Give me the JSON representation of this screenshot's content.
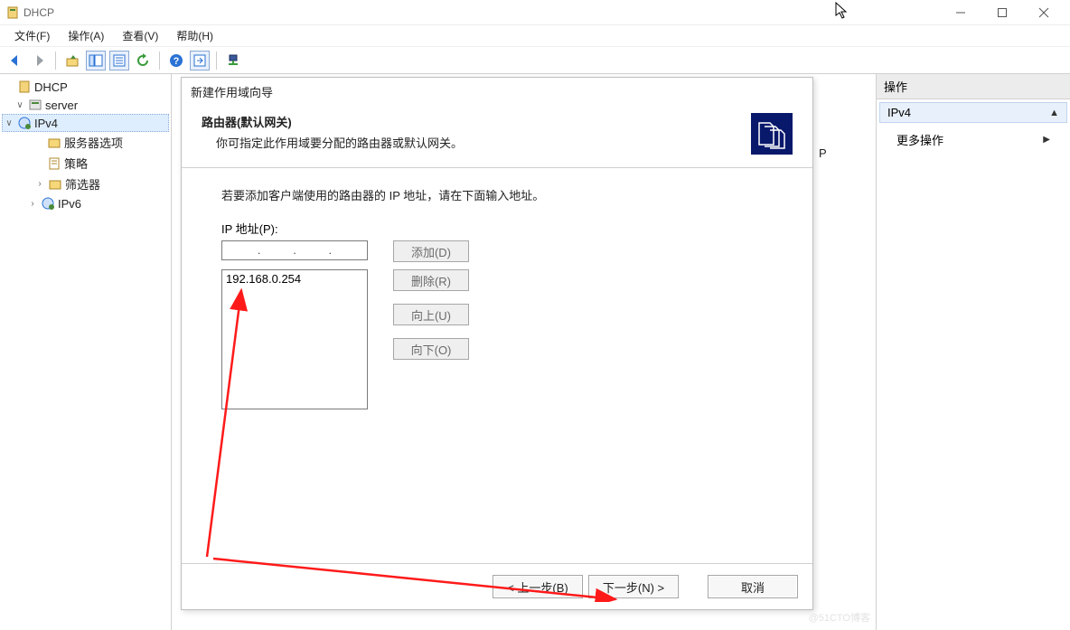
{
  "window": {
    "title": "DHCP"
  },
  "menu": {
    "file": "文件(F)",
    "action": "操作(A)",
    "view": "查看(V)",
    "help": "帮助(H)"
  },
  "tree": {
    "root": "DHCP",
    "server": "server",
    "ipv4": "IPv4",
    "server_options": "服务器选项",
    "policies": "策略",
    "filters": "筛选器",
    "ipv6": "IPv6"
  },
  "side_letter": "P",
  "actions": {
    "header": "操作",
    "group": "IPv4",
    "more": "更多操作"
  },
  "wizard": {
    "window_title": "新建作用域向导",
    "header_title": "路由器(默认网关)",
    "header_desc": "你可指定此作用域要分配的路由器或默认网关。",
    "body_text": "若要添加客户端使用的路由器的 IP 地址，请在下面输入地址。",
    "ip_label": "IP 地址(P):",
    "ip_value": "",
    "list_value": "192.168.0.254",
    "btn_add": "添加(D)",
    "btn_remove": "删除(R)",
    "btn_up": "向上(U)",
    "btn_down": "向下(O)",
    "btn_back": "< 上一步(B)",
    "btn_next": "下一步(N) >",
    "btn_cancel": "取消"
  }
}
